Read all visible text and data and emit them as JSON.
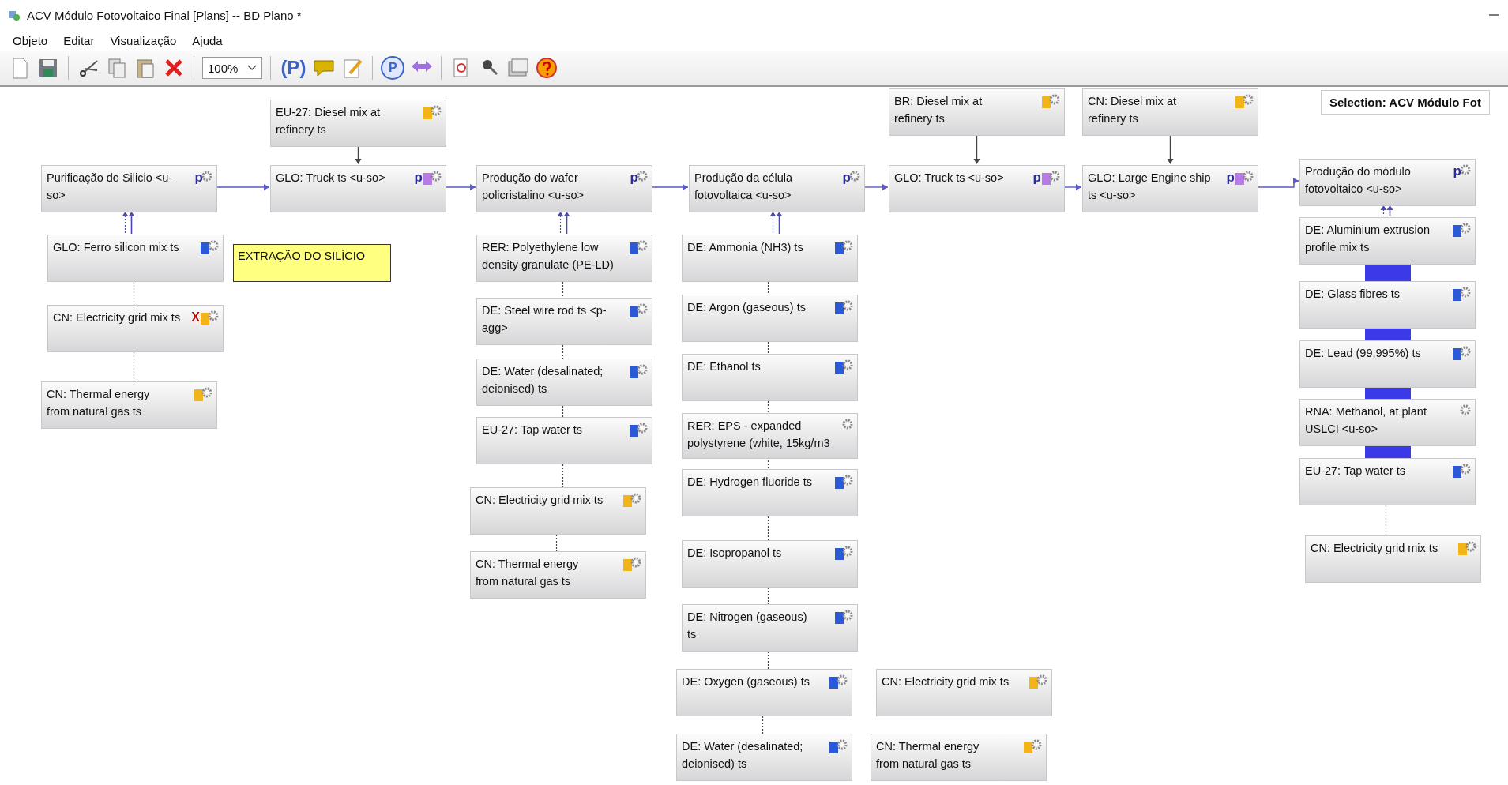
{
  "window": {
    "title": "ACV Módulo Fotovoltaico Final [Plans] -- BD Plano *"
  },
  "menu": [
    "Objeto",
    "Editar",
    "Visualização",
    "Ajuda"
  ],
  "toolbar": {
    "zoom": "100%",
    "plan_button": "(P)",
    "parameter_button": "P"
  },
  "selection": "Selection: ACV Módulo Fot",
  "note": "EXTRAÇÃO DO SILÍCIO",
  "nodes": [
    {
      "label": "EU-27: Diesel mix at refinery ts",
      "color": "#f3b41a"
    },
    {
      "label": "BR: Diesel mix at refinery ts",
      "color": "#f3b41a"
    },
    {
      "label": "CN: Diesel mix at refinery ts",
      "color": "#f3b41a"
    },
    {
      "label": "Purificação do Silicio <u-so>",
      "badge": "p"
    },
    {
      "label": "GLO: Truck ts <u-so>",
      "badge": "p",
      "color": "#b77ae6"
    },
    {
      "label": "Produção do wafer policristalino <u-so>",
      "badge": "p"
    },
    {
      "label": "Produção da célula fotovoltaica <u-so>",
      "badge": "p"
    },
    {
      "label": "GLO: Truck ts <u-so>",
      "badge": "p",
      "color": "#b77ae6"
    },
    {
      "label": "GLO: Large Engine ship ts <u-so>",
      "badge": "p",
      "color": "#b77ae6"
    },
    {
      "label": "Produção do módulo fotovoltaico <u-so>",
      "badge": "p"
    },
    {
      "label": "GLO: Ferro silicon mix ts",
      "color": "#2a5ad8"
    },
    {
      "label": "RER: Polyethylene low density granulate (PE-LD)",
      "color": "#2a5ad8"
    },
    {
      "label": "DE: Ammonia (NH3) ts",
      "color": "#2a5ad8"
    },
    {
      "label": "DE: Aluminium extrusion profile mix ts",
      "color": "#2a5ad8"
    },
    {
      "label": "CN: Electricity grid mix ts",
      "flag": "X",
      "color": "#f3b41a"
    },
    {
      "label": "DE: Steel wire rod ts <p-agg>",
      "color": "#2a5ad8"
    },
    {
      "label": "DE: Argon (gaseous) ts",
      "color": "#2a5ad8"
    },
    {
      "label": "DE: Glass fibres ts",
      "color": "#2a5ad8"
    },
    {
      "label": "DE: Water (desalinated; deionised) ts",
      "color": "#2a5ad8"
    },
    {
      "label": "DE: Ethanol ts",
      "color": "#2a5ad8"
    },
    {
      "label": "DE: Lead (99,995%) ts",
      "color": "#2a5ad8"
    },
    {
      "label": "CN: Thermal energy from natural gas ts",
      "color": "#f3b41a"
    },
    {
      "label": "EU-27: Tap water ts",
      "color": "#2a5ad8"
    },
    {
      "label": "RER: EPS - expanded polystyrene (white, 15kg/m3"
    },
    {
      "label": "RNA: Methanol, at plant USLCI <u-so>"
    },
    {
      "label": "CN: Electricity grid mix ts",
      "color": "#f3b41a"
    },
    {
      "label": "DE: Hydrogen fluoride ts",
      "color": "#2a5ad8"
    },
    {
      "label": "EU-27: Tap water ts",
      "color": "#2a5ad8"
    },
    {
      "label": "CN: Thermal energy from natural gas ts",
      "color": "#f3b41a"
    },
    {
      "label": "DE: Isopropanol ts",
      "color": "#2a5ad8"
    },
    {
      "label": "CN: Electricity grid mix ts",
      "color": "#f3b41a"
    },
    {
      "label": "DE: Nitrogen (gaseous) ts",
      "color": "#2a5ad8"
    },
    {
      "label": "DE: Oxygen (gaseous) ts",
      "color": "#2a5ad8"
    },
    {
      "label": "CN: Electricity grid mix ts",
      "color": "#f3b41a"
    },
    {
      "label": "DE: Water (desalinated; deionised) ts",
      "color": "#2a5ad8"
    },
    {
      "label": "CN: Thermal energy from natural gas ts",
      "color": "#f3b41a"
    }
  ]
}
